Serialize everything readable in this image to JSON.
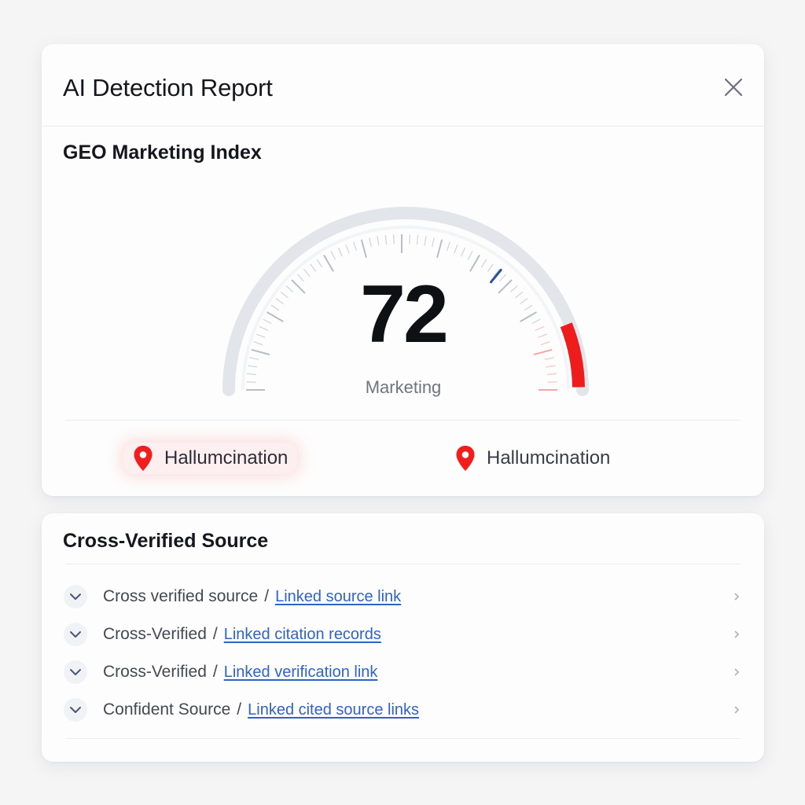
{
  "report": {
    "title": "AI Detection Report",
    "close_icon": "close-icon",
    "section_title": "GEO Marketing Index",
    "gauge": {
      "value": "72",
      "value_fraction": 0.72,
      "label": "Marketing",
      "track_color": "#e2e5ea",
      "accent_color": "#ee1c1c",
      "needle_color": "#2d4f9c"
    },
    "tags": [
      {
        "label": "Hallumcination",
        "icon": "location-pin-icon",
        "active": true
      },
      {
        "label": "Hallumcination",
        "icon": "location-pin-icon",
        "active": false
      }
    ]
  },
  "sources": {
    "title": "Cross-Verified Source",
    "items": [
      {
        "name": "Cross verified source",
        "link": "Linked source link"
      },
      {
        "name": "Cross-Verified",
        "link": "Linked citation records"
      },
      {
        "name": "Cross-Verified",
        "link": "Linked verification link"
      },
      {
        "name": "Confident Source",
        "link": "Linked cited source links"
      }
    ]
  }
}
